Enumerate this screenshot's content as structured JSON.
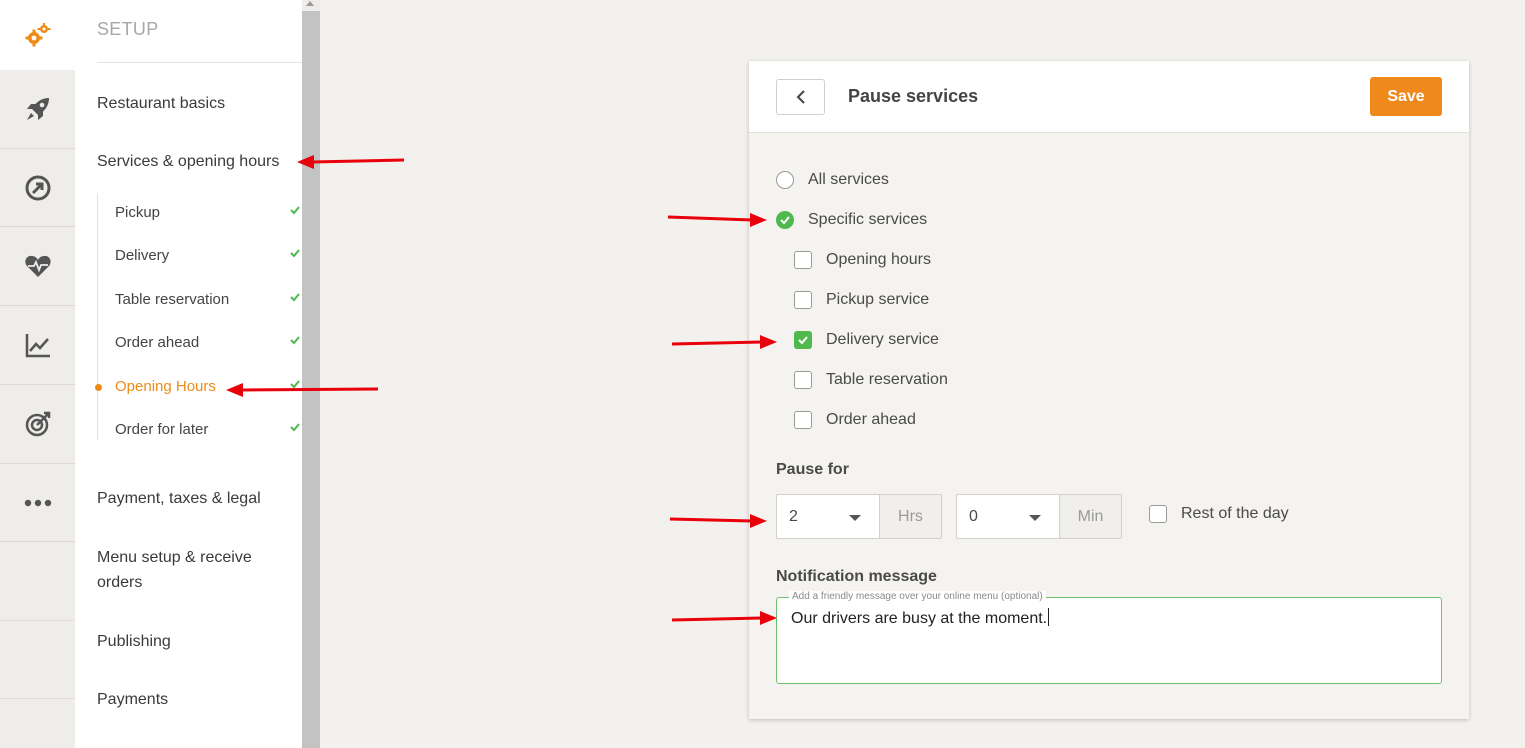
{
  "rail": {
    "items": [
      {
        "icon": "gears-icon",
        "active": true
      },
      {
        "icon": "rocket-icon"
      },
      {
        "icon": "growth-circle-icon"
      },
      {
        "icon": "heartbeat-icon"
      },
      {
        "icon": "line-chart-icon"
      },
      {
        "icon": "target-icon"
      },
      {
        "icon": "more-dots-icon"
      }
    ]
  },
  "nav": {
    "title": "SETUP",
    "items": [
      {
        "label": "Restaurant basics"
      },
      {
        "label": "Services & opening hours"
      },
      {
        "label": "Payment, taxes & legal"
      },
      {
        "label": "Menu setup & receive orders"
      },
      {
        "label": "Publishing"
      },
      {
        "label": "Payments"
      }
    ],
    "sub_items": [
      {
        "label": "Pickup",
        "complete": true
      },
      {
        "label": "Delivery",
        "complete": true
      },
      {
        "label": "Table reservation",
        "complete": true
      },
      {
        "label": "Order ahead",
        "complete": true
      },
      {
        "label": "Opening Hours",
        "complete": true,
        "active": true
      },
      {
        "label": "Order for later",
        "complete": true
      }
    ]
  },
  "panel": {
    "title": "Pause services",
    "save_label": "Save",
    "scope_options": [
      {
        "label": "All services",
        "selected": false
      },
      {
        "label": "Specific services",
        "selected": true
      }
    ],
    "services": [
      {
        "label": "Opening hours",
        "checked": false
      },
      {
        "label": "Pickup service",
        "checked": false
      },
      {
        "label": "Delivery service",
        "checked": true
      },
      {
        "label": "Table reservation",
        "checked": false
      },
      {
        "label": "Order ahead",
        "checked": false
      }
    ],
    "pause_for": {
      "label": "Pause for",
      "hours_value": "2",
      "hours_unit": "Hrs",
      "minutes_value": "0",
      "minutes_unit": "Min",
      "rest_of_day_label": "Rest of the day",
      "rest_of_day_checked": false
    },
    "notification": {
      "label": "Notification message",
      "hint": "Add a friendly message over your online menu (optional)",
      "value": "Our drivers are busy at the moment."
    }
  },
  "colors": {
    "accent": "#f0891c",
    "success": "#4fb84f",
    "annotation": "#e8000b"
  }
}
